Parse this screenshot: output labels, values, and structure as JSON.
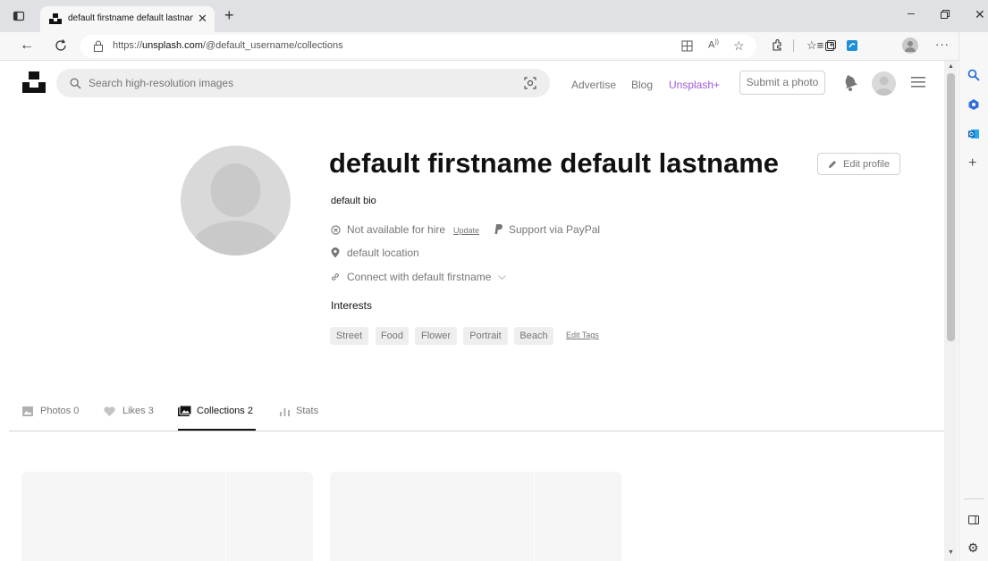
{
  "browser": {
    "tab_title": "default firstname default lastnam",
    "url_prefix": "https://",
    "url_host": "unsplash.com",
    "url_path": "/@default_username/collections"
  },
  "header": {
    "search_placeholder": "Search high-resolution images",
    "nav": [
      "Advertise",
      "Blog",
      "Unsplash+"
    ],
    "submit_label": "Submit a photo",
    "unsplash_plus_color": "#9f5ade"
  },
  "profile": {
    "name": "default firstname default lastname",
    "edit_label": "Edit profile",
    "bio": "default bio",
    "hire_status": "Not available for hire",
    "hire_update": "Update",
    "paypal": "Support via PayPal",
    "location": "default location",
    "connect": "Connect with default firstname",
    "interests_title": "Interests",
    "tags": [
      "Street",
      "Food",
      "Flower",
      "Portrait",
      "Beach"
    ],
    "edit_tags": "Edit Tags"
  },
  "tabs": [
    {
      "label": "Photos 0",
      "active": false
    },
    {
      "label": "Likes 3",
      "active": false
    },
    {
      "label": "Collections 2",
      "active": true
    },
    {
      "label": "Stats",
      "active": false
    }
  ]
}
